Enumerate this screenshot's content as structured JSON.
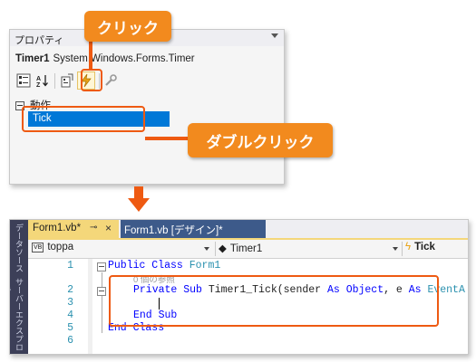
{
  "properties_panel": {
    "title": "プロパティ",
    "object_name": "Timer1",
    "object_type": "System.Windows.Forms.Timer",
    "toolbar_icons": [
      "categorized-icon",
      "alphabetical-icon",
      "properties-icon",
      "events-icon",
      "property-pages-icon"
    ],
    "category": "動作",
    "event_name": "Tick"
  },
  "annotations": {
    "click": "クリック",
    "double_click": "ダブルクリック",
    "accent_color": "#ee5a12"
  },
  "editor": {
    "side_labels": [
      "データソース",
      "サーバーエクスプローラー"
    ],
    "tabs": [
      {
        "label": "Form1.vb*",
        "pin": "⊸",
        "close": "×"
      },
      {
        "label": "Form1.vb [デザイン]*"
      }
    ],
    "nav": {
      "project": "toppa",
      "project_badge": "VB",
      "object": "Timer1",
      "event": "Tick"
    },
    "line_numbers": [
      "1",
      "2",
      "3",
      "4",
      "5",
      "6"
    ],
    "reference_hint": "0 個の参照",
    "code": {
      "line1_kw": "Public Class",
      "line1_name": "Form1",
      "line2_kw": "Private Sub",
      "line2_rest": "Timer1_Tick(sender",
      "line2_as1": "As",
      "line2_type1": "Object",
      "line2_mid": ", e",
      "line2_as2": "As",
      "line2_type2": "EventA",
      "line4": "End Sub",
      "line5": "End Class"
    }
  }
}
